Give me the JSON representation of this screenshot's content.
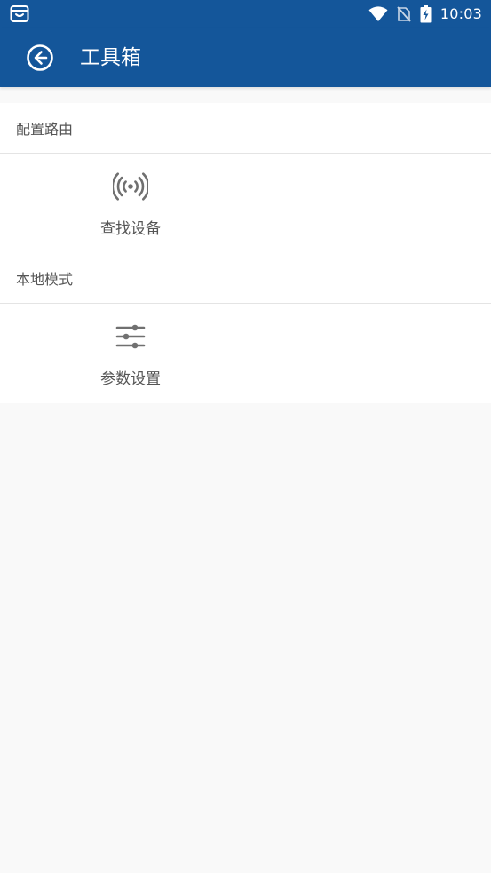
{
  "status_bar": {
    "time": "10:03",
    "icons": [
      "app-notification-icon",
      "wifi-icon",
      "no-sim-icon",
      "battery-charging-icon"
    ]
  },
  "app_bar": {
    "title": "工具箱",
    "back_icon": "back-arrow-circle-icon"
  },
  "sections": [
    {
      "header": "配置路由",
      "tiles": [
        {
          "label": "查找设备",
          "icon": "broadcast-signal-icon"
        }
      ]
    },
    {
      "header": "本地模式",
      "tiles": [
        {
          "label": "参数设置",
          "icon": "sliders-settings-icon"
        }
      ]
    }
  ],
  "colors": {
    "primary": "#14569a",
    "background": "#f9f9f9",
    "card": "#ffffff",
    "text": "#555555",
    "icon": "#707070",
    "divider": "#e4e4e4"
  }
}
